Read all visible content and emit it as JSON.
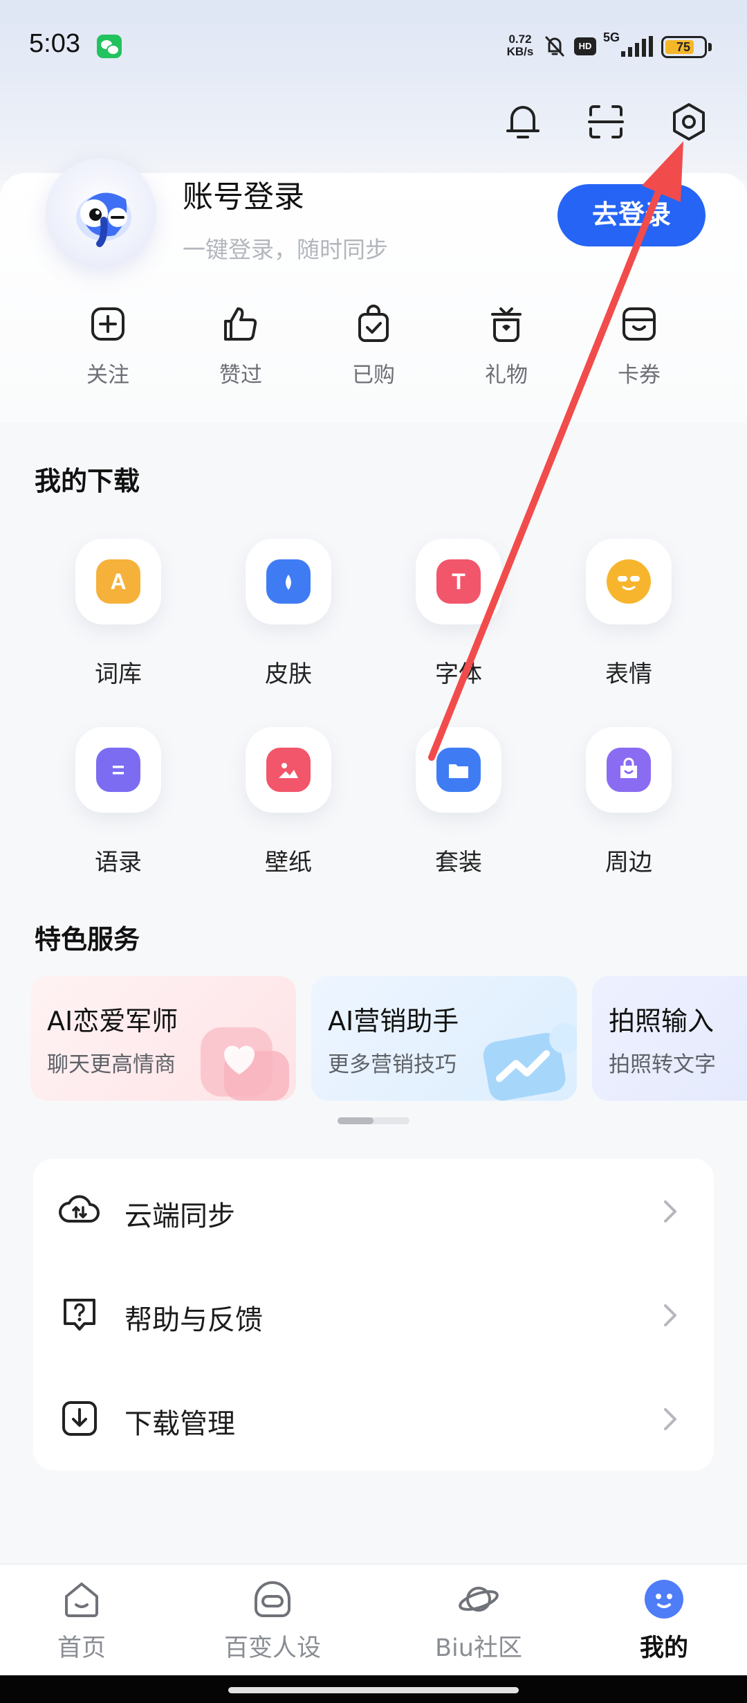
{
  "status_bar": {
    "time": "5:03",
    "net_speed_value": "0.72",
    "net_speed_unit": "KB/s",
    "hd_label": "HD",
    "network_type": "5G",
    "battery_level": "75",
    "battery_fraction": 0.75
  },
  "header": {
    "icons": [
      "bell-icon",
      "scan-icon",
      "settings-icon"
    ]
  },
  "profile": {
    "title": "账号登录",
    "subtitle": "一键登录，随时同步",
    "login_button": "去登录"
  },
  "quick_actions": [
    {
      "label": "关注",
      "icon": "plus-square-icon"
    },
    {
      "label": "赞过",
      "icon": "thumbs-up-icon"
    },
    {
      "label": "已购",
      "icon": "shopping-bag-icon"
    },
    {
      "label": "礼物",
      "icon": "gift-icon"
    },
    {
      "label": "卡券",
      "icon": "coupon-icon"
    }
  ],
  "downloads": {
    "title": "我的下载",
    "items": [
      {
        "label": "词库",
        "icon": "lexicon-icon",
        "glyph": "A",
        "color": "#f6b13b"
      },
      {
        "label": "皮肤",
        "icon": "skin-icon",
        "glyph": "",
        "color": "#3f7cf4"
      },
      {
        "label": "字体",
        "icon": "font-icon",
        "glyph": "T",
        "color": "#f2566b"
      },
      {
        "label": "表情",
        "icon": "emoji-icon",
        "glyph": "",
        "color": "#f7b52e"
      },
      {
        "label": "语录",
        "icon": "quotes-icon",
        "glyph": "=",
        "color": "#7b6cf2"
      },
      {
        "label": "壁纸",
        "icon": "wallpaper-icon",
        "glyph": "",
        "color": "#f2566b"
      },
      {
        "label": "套装",
        "icon": "bundle-icon",
        "glyph": "",
        "color": "#3f7cf4"
      },
      {
        "label": "周边",
        "icon": "merch-icon",
        "glyph": "",
        "color": "#8a6cf2"
      }
    ]
  },
  "services": {
    "title": "特色服务",
    "cards": [
      {
        "title": "AI恋爱军师",
        "subtitle": "聊天更高情商",
        "icon": "hearts-icon"
      },
      {
        "title": "AI营销助手",
        "subtitle": "更多营销技巧",
        "icon": "trend-chart-icon"
      },
      {
        "title": "拍照输入",
        "subtitle": "拍照转文字",
        "icon": "camera-icon"
      }
    ],
    "scroll_position": 0.0
  },
  "menu": [
    {
      "label": "云端同步",
      "icon": "cloud-sync-icon"
    },
    {
      "label": "帮助与反馈",
      "icon": "help-icon"
    },
    {
      "label": "下载管理",
      "icon": "download-icon"
    }
  ],
  "tab_bar": {
    "items": [
      {
        "label": "首页",
        "icon": "home-icon",
        "active": false
      },
      {
        "label": "百变人设",
        "icon": "persona-icon",
        "active": false
      },
      {
        "label": "Biu社区",
        "icon": "planet-icon",
        "active": false
      },
      {
        "label": "我的",
        "icon": "me-icon",
        "active": true
      }
    ]
  },
  "colors": {
    "accent": "#2564f5",
    "annotation_arrow": "#f24b4b",
    "background": "#f7f8fa"
  }
}
